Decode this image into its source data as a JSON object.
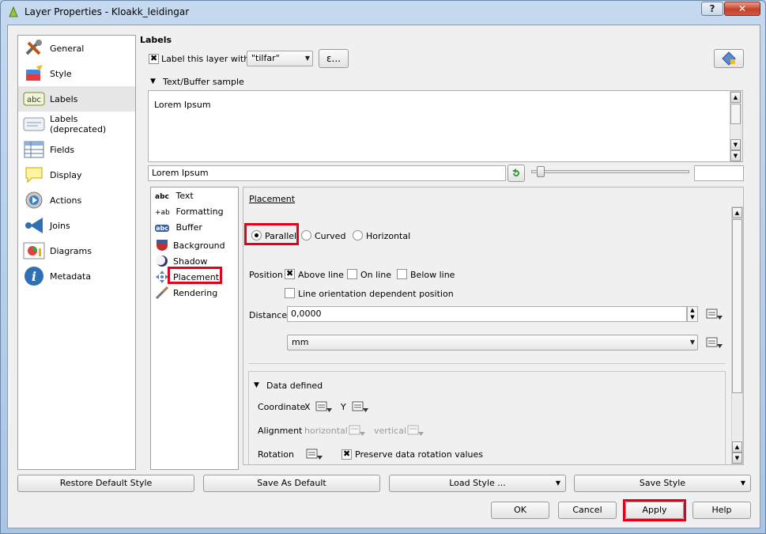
{
  "window": {
    "title": "Layer Properties - Kloakk_leidingar",
    "help_glyph": "?",
    "close_glyph": "✕"
  },
  "sidebar": {
    "items": [
      {
        "label": "General"
      },
      {
        "label": "Style"
      },
      {
        "label": "Labels"
      },
      {
        "label": "Labels (deprecated)"
      },
      {
        "label": "Fields"
      },
      {
        "label": "Display"
      },
      {
        "label": "Actions"
      },
      {
        "label": "Joins"
      },
      {
        "label": "Diagrams"
      },
      {
        "label": "Metadata"
      }
    ]
  },
  "labels_panel": {
    "title": "Labels",
    "label_checkbox": "Label this layer with",
    "field_value": "\"tilfar\"",
    "expression_label": "ε...",
    "sample_header": "Text/Buffer sample",
    "sample_text": "Lorem Ipsum",
    "sample_input": "Lorem Ipsum"
  },
  "tabs": {
    "items": [
      {
        "icon_text": "abc",
        "label": "Text"
      },
      {
        "icon_text": "+ab",
        "label": "Formatting"
      },
      {
        "icon_text": "abc",
        "label": "Buffer"
      },
      {
        "icon_text": "",
        "label": "Background"
      },
      {
        "icon_text": "",
        "label": "Shadow"
      },
      {
        "icon_text": "",
        "label": "Placement"
      },
      {
        "icon_text": "",
        "label": "Rendering"
      }
    ]
  },
  "placement": {
    "header": "Placement",
    "modes": [
      "Parallel",
      "Curved",
      "Horizontal"
    ],
    "position_label": "Position",
    "position_options": [
      "Above line",
      "On line",
      "Below line"
    ],
    "orientation_option": "Line orientation dependent position",
    "distance_label": "Distance",
    "distance_value": "0,0000",
    "unit_value": "mm",
    "data_defined_header": "Data defined",
    "coordinate_label": "Coordinate",
    "x_label": "X",
    "y_label": "Y",
    "alignment_label": "Alignment",
    "alignment_h": "horizontal",
    "alignment_v": "vertical",
    "rotation_label": "Rotation",
    "preserve_rotation": "Preserve data rotation values"
  },
  "bottom": {
    "restore_default": "Restore Default Style",
    "save_as_default": "Save As Default",
    "load_style": "Load Style ...",
    "save_style": "Save Style",
    "ok": "OK",
    "cancel": "Cancel",
    "apply": "Apply",
    "help": "Help"
  },
  "colors": {
    "highlight": "#e2001a",
    "title_bar": "#b9d1ea",
    "panel_bg": "#f0f0f0"
  }
}
